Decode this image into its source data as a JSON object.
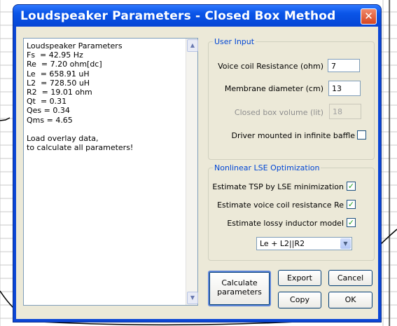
{
  "window": {
    "title": "Loudspeaker Parameters - Closed Box Method",
    "close_glyph": "✕"
  },
  "results_text": "Loudspeaker Parameters\nFs  = 42.95 Hz\nRe  = 7.20 ohm[dc]\nLe  = 658.91 uH\nL2  = 728.50 uH\nR2  = 19.01 ohm\nQt  = 0.31\nQes = 0.34\nQms = 4.65\n\nLoad overlay data,\nto calculate all parameters!",
  "user_input": {
    "legend": "User Input",
    "voice_coil_label": "Voice coil Resistance (ohm)",
    "voice_coil_value": "7",
    "membrane_label": "Membrane diameter (cm)",
    "membrane_value": "13",
    "box_volume_label": "Closed box volume (lit)",
    "box_volume_value": "18",
    "infinite_baffle_label": "Driver mounted in infinite baffle",
    "infinite_baffle_checked": false
  },
  "optimization": {
    "legend": "Nonlinear LSE Optimization",
    "tsp_label": "Estimate TSP by LSE minimization",
    "tsp_checked": true,
    "re_label": "Estimate voice coil resistance Re",
    "re_checked": true,
    "lossy_label": "Estimate lossy inductor model",
    "lossy_checked": true,
    "model_selected": "Le + L2||R2"
  },
  "buttons": {
    "calculate": "Calculate parameters",
    "export": "Export",
    "cancel": "Cancel",
    "copy": "Copy",
    "ok": "OK"
  },
  "check_glyph": "✓"
}
